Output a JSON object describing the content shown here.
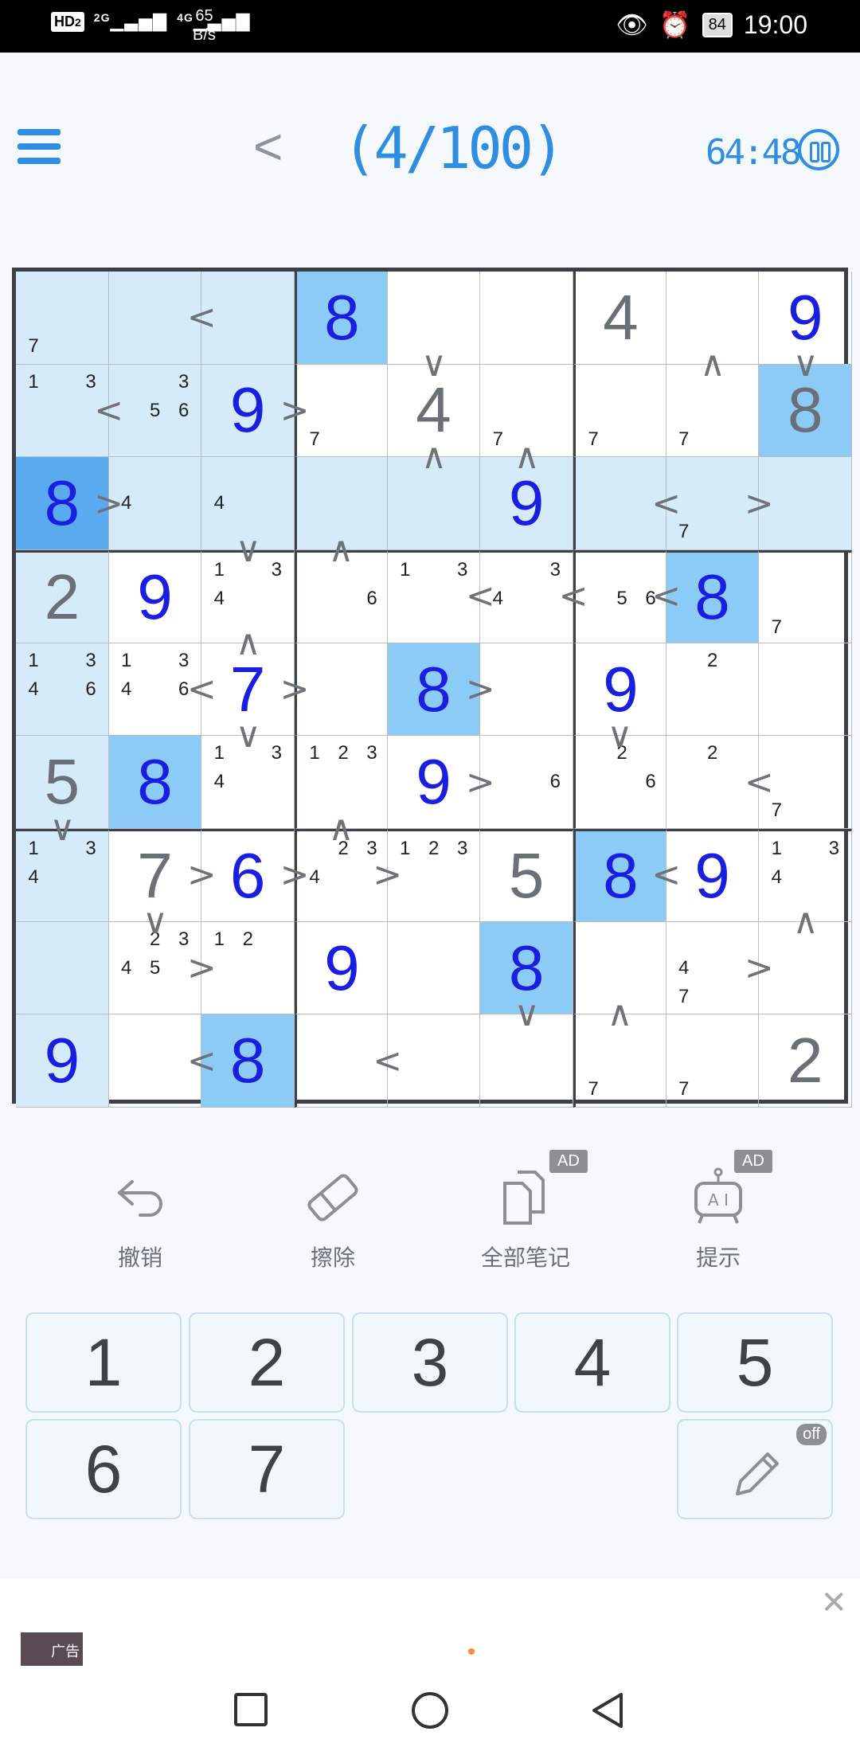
{
  "status_bar": {
    "hd": "HD",
    "sim": "2",
    "net1": "2G",
    "net2": "4G",
    "speed_value": "65",
    "speed_unit": "B/s",
    "battery": "84",
    "time": "19:00"
  },
  "header": {
    "menu_icon": "menu-icon",
    "back_icon": "chevron-left-icon",
    "level": "(4/100)",
    "timer": "64:48",
    "pause_icon": "pause-icon"
  },
  "board": {
    "size": 9,
    "selected": "r3c1",
    "grid": [
      [
        null,
        null,
        null,
        8,
        null,
        null,
        4,
        null,
        9
      ],
      [
        null,
        null,
        9,
        null,
        4,
        null,
        null,
        null,
        8
      ],
      [
        8,
        null,
        null,
        null,
        null,
        9,
        null,
        null,
        null
      ],
      [
        2,
        9,
        null,
        null,
        null,
        null,
        null,
        8,
        null
      ],
      [
        null,
        null,
        7,
        null,
        8,
        null,
        9,
        null,
        null
      ],
      [
        5,
        8,
        null,
        null,
        9,
        null,
        null,
        null,
        null
      ],
      [
        null,
        7,
        6,
        null,
        null,
        5,
        8,
        9,
        null
      ],
      [
        null,
        null,
        null,
        9,
        null,
        8,
        null,
        null,
        null
      ],
      [
        9,
        null,
        8,
        null,
        null,
        null,
        null,
        null,
        2
      ]
    ],
    "given": [
      [
        null,
        null,
        null,
        null,
        null,
        null,
        4,
        null,
        null
      ],
      [
        null,
        null,
        null,
        null,
        4,
        null,
        null,
        null,
        8
      ],
      [
        null,
        null,
        null,
        null,
        null,
        null,
        null,
        null,
        null
      ],
      [
        2,
        null,
        null,
        null,
        null,
        null,
        null,
        null,
        null
      ],
      [
        null,
        null,
        null,
        null,
        null,
        null,
        null,
        null,
        null
      ],
      [
        5,
        null,
        null,
        null,
        null,
        null,
        null,
        null,
        null
      ],
      [
        null,
        7,
        null,
        null,
        null,
        5,
        null,
        null,
        null
      ],
      [
        null,
        null,
        null,
        null,
        null,
        null,
        null,
        null,
        null
      ],
      [
        null,
        null,
        null,
        null,
        null,
        null,
        null,
        null,
        2
      ]
    ],
    "notes": {
      "0-0": [
        7
      ],
      "1-0": [
        1,
        3
      ],
      "1-1": [
        3,
        5,
        6
      ],
      "1-3": [
        7
      ],
      "1-5": [
        7
      ],
      "1-6": [
        7
      ],
      "1-7": [
        7
      ],
      "2-1": [
        4
      ],
      "2-2": [
        4
      ],
      "2-7": [
        7
      ],
      "3-2": [
        1,
        3,
        4
      ],
      "3-3": [
        6
      ],
      "3-4": [
        1,
        3
      ],
      "3-5": [
        3,
        4
      ],
      "3-6": [
        5,
        6
      ],
      "3-8": [
        7
      ],
      "4-0": [
        1,
        3,
        4,
        6
      ],
      "4-1": [
        1,
        3,
        4,
        6
      ],
      "4-7": [
        2
      ],
      "5-2": [
        1,
        3,
        4
      ],
      "5-3": [
        1,
        2,
        3
      ],
      "5-5": [
        6
      ],
      "5-6": [
        2,
        6
      ],
      "5-7": [
        2
      ],
      "5-8": [
        7
      ],
      "6-0": [
        1,
        3,
        4
      ],
      "6-3": [
        2,
        3,
        4
      ],
      "6-4": [
        1,
        2,
        3
      ],
      "6-8": [
        1,
        3,
        4
      ],
      "7-1": [
        2,
        3,
        4,
        5
      ],
      "7-2": [
        1,
        2
      ],
      "7-7": [
        4,
        7
      ],
      "8-6": [
        7
      ],
      "8-7": [
        7
      ]
    },
    "signs_h": {
      "0-1": "<",
      "1-0": "<",
      "1-2": ">",
      "2-0": ">",
      "2-6": "<",
      "2-7": ">",
      "3-4": "<",
      "3-5": "<",
      "3-6": "<",
      "4-1": "<",
      "4-2": ">",
      "4-4": ">",
      "5-4": ">",
      "5-7": "<",
      "6-1": ">",
      "6-2": ">",
      "6-3": ">",
      "6-6": "<",
      "7-1": ">",
      "7-7": ">",
      "8-1": "<",
      "8-3": "<"
    },
    "signs_v": {
      "0-4": "v",
      "0-7": "^",
      "0-8": "v",
      "1-4": "^",
      "1-5": "^",
      "2-2": "v",
      "2-3": "^",
      "3-2": "^",
      "4-2": "v",
      "4-6": "v",
      "5-0": "v",
      "5-3": "^",
      "6-1": "v",
      "6-8": "^",
      "7-5": "v",
      "7-6": "^"
    }
  },
  "tools": [
    {
      "label": "撤销",
      "icon": "undo-icon",
      "ad": ""
    },
    {
      "label": "擦除",
      "icon": "eraser-icon",
      "ad": ""
    },
    {
      "label": "全部笔记",
      "icon": "notes-icon",
      "ad": "AD"
    },
    {
      "label": "提示",
      "icon": "ai-hint-icon",
      "ad": "AD"
    }
  ],
  "keypad": {
    "digits": [
      "1",
      "2",
      "3",
      "4",
      "5",
      "6",
      "7"
    ],
    "pencil_icon": "pencil-icon",
    "pencil_state": "off"
  },
  "ad_bar": {
    "label": "广告",
    "close_icon": "close-icon"
  },
  "nav_bar": {
    "icons": [
      "recent-apps-icon",
      "home-icon",
      "back-icon"
    ]
  },
  "colors": {
    "accent": "#2f8ee2",
    "user_digit": "#1a1ee0",
    "given_digit": "#6b7078",
    "highlight": "#d5ebfa",
    "same_value": "#8ccbf5",
    "selected": "#5aaaf0"
  }
}
